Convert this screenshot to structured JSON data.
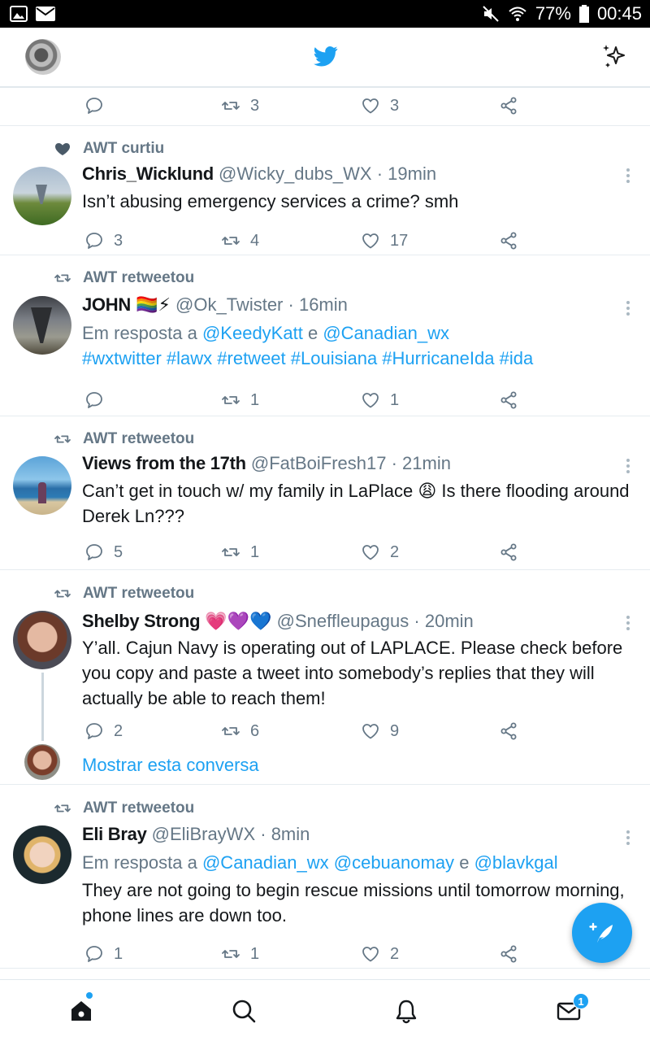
{
  "status_bar": {
    "battery": "77%",
    "time": "00:45"
  },
  "header": {
    "title_icon": "twitter-bird-icon",
    "left": "profile-avatar",
    "right": "sparkle-icon"
  },
  "partial_tweet": {
    "retweets": "3",
    "likes": "3"
  },
  "tweets": [
    {
      "context": "AWT curtiu",
      "name": "Chris_Wicklund",
      "handle": "@Wicky_dubs_WX",
      "time": "· 19min",
      "text": "Isn’t abusing emergency services a crime? smh",
      "replies": "3",
      "retweets": "4",
      "likes": "17"
    },
    {
      "context": "AWT retweetou",
      "name": "JOHN",
      "name_emoji": "🏳️‍🌈⚡",
      "handle": "@Ok_Twister",
      "time": "· 16min",
      "reply_prefix": "Em resposta a",
      "reply_to_1": "@KeedyKatt",
      "reply_and": "e",
      "reply_to_2": "@Canadian_wx",
      "hashtags": "#wxtwitter #lawx #retweet #Louisiana #HurricaneIda #ida",
      "replies": "",
      "retweets": "1",
      "likes": "1"
    },
    {
      "context": "AWT retweetou",
      "name": "Views from the 17th",
      "handle": "@FatBoiFresh17",
      "time": "· 21min",
      "text_1": "Can’t get in touch w/ my family in LaPlace",
      "text_emoji": "😩",
      "text_2": "Is there flooding around Derek Ln???",
      "replies": "5",
      "retweets": "1",
      "likes": "2"
    },
    {
      "context": "AWT retweetou",
      "name": "Shelby Strong",
      "name_emoji": "💗💜💙",
      "handle": "@Sneffleupagus",
      "time": "· 20min",
      "text": "Y’all. Cajun Navy is operating out of LAPLACE. Please check before you copy and paste a tweet into somebody’s replies that they will actually be able to reach them!",
      "replies": "2",
      "retweets": "6",
      "likes": "9",
      "show_convo": "Mostrar esta conversa"
    },
    {
      "context": "AWT retweetou",
      "name": "Eli Bray",
      "handle": "@EliBrayWX",
      "time": "· 8min",
      "reply_prefix": "Em resposta a",
      "reply_to_1": "@Canadian_wx",
      "reply_to_2": "@cebuanomay",
      "reply_and": "e",
      "reply_to_3": "@blavkgal",
      "text": "They are not going to begin rescue missions until tomorrow morning, phone lines are down too.",
      "replies": "1",
      "retweets": "1",
      "likes": "2"
    }
  ],
  "bottom_nav": {
    "dm_badge": "1"
  },
  "colors": {
    "accent": "#1da1f2",
    "muted": "#657786",
    "text": "#14171a"
  }
}
